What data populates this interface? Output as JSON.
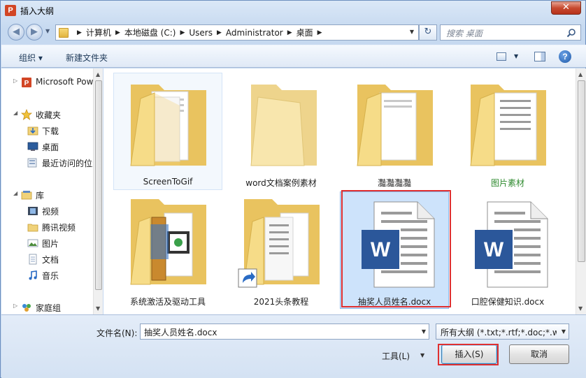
{
  "window": {
    "title": "插入大纲",
    "app_icon": "P",
    "close_glyph": "✕"
  },
  "nav": {
    "breadcrumbs": [
      "计算机",
      "本地磁盘 (C:)",
      "Users",
      "Administrator",
      "桌面"
    ],
    "search_placeholder": "搜索 桌面"
  },
  "toolbar": {
    "organize": "组织 ▾",
    "new_folder": "新建文件夹"
  },
  "sidebar": {
    "items": [
      {
        "label": "Microsoft PowerPoint",
        "icon": "powerpoint-icon"
      },
      {
        "label": "收藏夹",
        "icon": "star-icon"
      },
      {
        "label": "下载",
        "icon": "download-folder-icon"
      },
      {
        "label": "桌面",
        "icon": "desktop-icon"
      },
      {
        "label": "最近访问的位置",
        "icon": "recent-places-icon"
      },
      {
        "label": "库",
        "icon": "library-icon"
      },
      {
        "label": "视频",
        "icon": "video-library-icon"
      },
      {
        "label": "腾讯视频",
        "icon": "folder-icon"
      },
      {
        "label": "图片",
        "icon": "pictures-library-icon"
      },
      {
        "label": "文档",
        "icon": "documents-library-icon"
      },
      {
        "label": "音乐",
        "icon": "music-library-icon"
      },
      {
        "label": "家庭组",
        "icon": "homegroup-icon"
      }
    ]
  },
  "files": [
    {
      "name": "ScreenToGif",
      "type": "folder-docs",
      "state": "hover"
    },
    {
      "name": "word文档案例素材",
      "type": "folder-empty"
    },
    {
      "name": "灩灩灩灩",
      "type": "folder-docs"
    },
    {
      "name": "图片素材",
      "type": "folder-docs",
      "green": true
    },
    {
      "name": "系统激活及驱动工具",
      "type": "folder-qr"
    },
    {
      "name": "2021头条教程",
      "type": "folder-shortcut"
    },
    {
      "name": "抽奖人员姓名.docx",
      "type": "word",
      "state": "selected"
    },
    {
      "name": "口腔保健知识.docx",
      "type": "word"
    }
  ],
  "bottom": {
    "filename_label": "文件名(N):",
    "filename_value": "抽奖人员姓名.docx",
    "filetype_value": "所有大纲 (*.txt;*.rtf;*.doc;*.wpd",
    "tools_label": "工具(L)",
    "insert_label": "插入(S)",
    "cancel_label": "取消"
  },
  "colors": {
    "selection_highlight": "#e03030",
    "word_blue": "#2b579a",
    "folder_yellow": "#f3d27b"
  }
}
